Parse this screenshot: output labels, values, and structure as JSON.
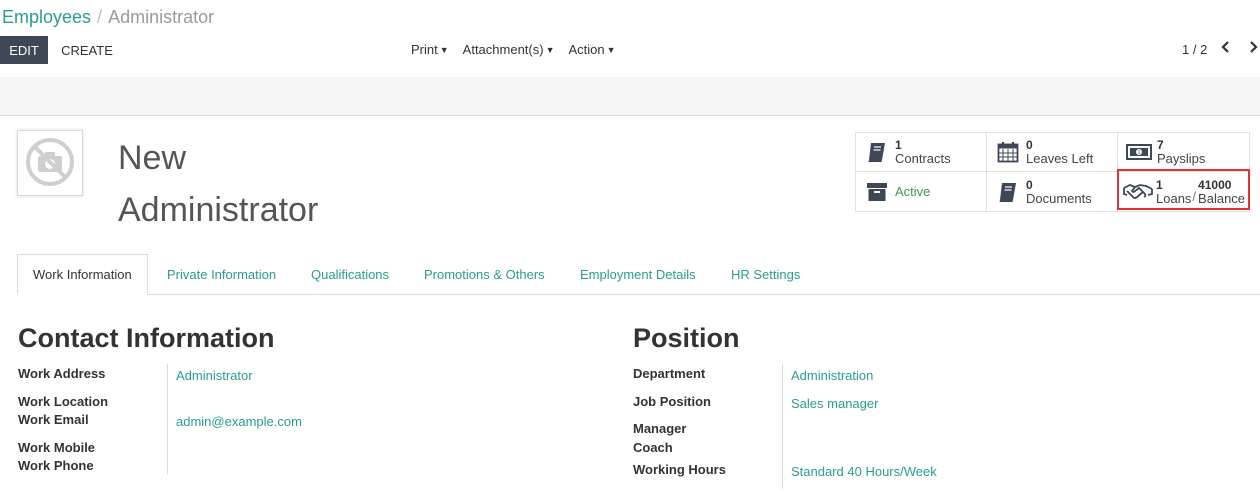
{
  "breadcrumb": {
    "parent": "Employees",
    "separator": "/",
    "current": "Administrator"
  },
  "toolbar": {
    "edit_label": "EDIT",
    "create_label": "CREATE",
    "print_label": "Print",
    "attachments_label": "Attachment(s)",
    "action_label": "Action",
    "pager": "1 / 2"
  },
  "employee": {
    "name_line1": "New",
    "name_line2": "Administrator"
  },
  "stats": {
    "contracts": {
      "count": "1",
      "label": "Contracts"
    },
    "leaves": {
      "count": "0",
      "label": "Leaves Left"
    },
    "payslips": {
      "count": "7",
      "label": "Payslips"
    },
    "active": {
      "label": "Active"
    },
    "documents": {
      "count": "0",
      "label": "Documents"
    },
    "loans": {
      "count": "1",
      "label": "Loans",
      "separator": "/",
      "balance_value": "41000",
      "balance_label": "Balance"
    }
  },
  "tabs": [
    {
      "label": "Work Information",
      "active": true
    },
    {
      "label": "Private Information"
    },
    {
      "label": "Qualifications"
    },
    {
      "label": "Promotions & Others"
    },
    {
      "label": "Employment Details"
    },
    {
      "label": "HR Settings"
    }
  ],
  "contact": {
    "title": "Contact Information",
    "work_address_label": "Work Address",
    "work_address_value": "Administrator",
    "work_location_label": "Work Location",
    "work_email_label": "Work Email",
    "work_email_value": "admin@example.com",
    "work_mobile_label": "Work Mobile",
    "work_phone_label": "Work Phone"
  },
  "position": {
    "title": "Position",
    "department_label": "Department",
    "department_value": "Administration",
    "job_position_label": "Job Position",
    "job_position_value": "Sales manager",
    "manager_label": "Manager",
    "coach_label": "Coach",
    "working_hours_label": "Working Hours",
    "working_hours_value": "Standard 40 Hours/Week"
  },
  "colors": {
    "accent": "#2a9d8f",
    "dark_button": "#3e4756",
    "active_status": "#3e9b4f",
    "highlight": "#e03232"
  },
  "icons": [
    "camera-slash-icon",
    "book-icon",
    "calendar-icon",
    "money-icon",
    "archive-icon",
    "handshake-icon",
    "chevron-left-icon",
    "chevron-right-icon",
    "caret-down-icon"
  ]
}
